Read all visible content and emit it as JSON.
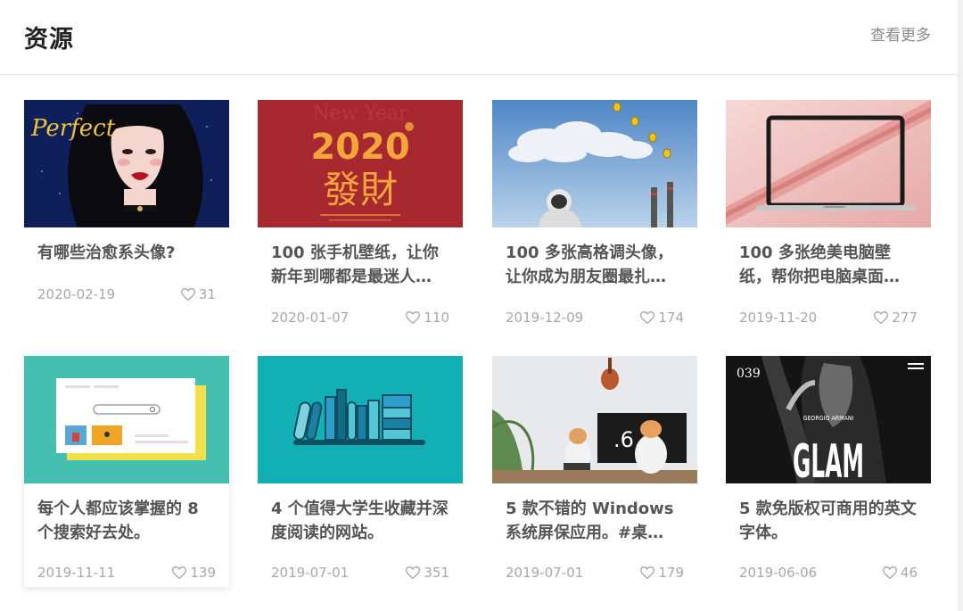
{
  "header": {
    "title": "资源",
    "more": "查看更多"
  },
  "cards": [
    {
      "title": "有哪些治愈系头像?",
      "date": "2020-02-19",
      "likes": "31",
      "art_text": "Perfect",
      "icon": "heart-icon"
    },
    {
      "title": "100 张手机壁纸，让你新年到哪都是最迷人…",
      "date": "2020-01-07",
      "likes": "110",
      "art_text": {
        "header": "New Year",
        "year": "2020",
        "chars": "發財"
      },
      "icon": "heart-icon"
    },
    {
      "title": "100 多张高格调头像，让你成为朋友圈最扎…",
      "date": "2019-12-09",
      "likes": "174",
      "icon": "heart-icon"
    },
    {
      "title": "100 多张绝美电脑壁纸，帮你把电脑桌面…",
      "date": "2019-11-20",
      "likes": "277",
      "icon": "heart-icon"
    },
    {
      "title": "每个人都应该掌握的 8 个搜索好去处。",
      "date": "2019-11-11",
      "likes": "139",
      "icon": "heart-icon"
    },
    {
      "title": "4 个值得大学生收藏并深度阅读的网站。",
      "date": "2019-07-01",
      "likes": "351",
      "icon": "heart-icon"
    },
    {
      "title": "5 款不错的 Windows 系统屏保应用。#桌…",
      "date": "2019-07-01",
      "likes": "179",
      "art_text": ".6",
      "icon": "heart-icon"
    },
    {
      "title": "5 款免版权可商用的英文字体。",
      "date": "2019-06-06",
      "likes": "46",
      "art_text": {
        "number": "039",
        "name": "GEORGIO ARMANI",
        "word": "GLAM"
      },
      "icon": "heart-icon"
    }
  ],
  "colors": {
    "title": "#555555",
    "meta": "#a8a8a8",
    "accent_red": "#a8282f",
    "teal": "#45bfb0"
  }
}
